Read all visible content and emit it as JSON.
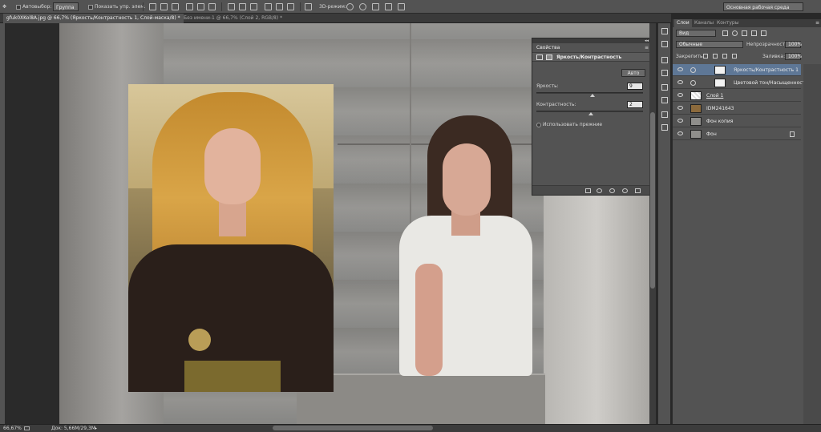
{
  "options_bar": {
    "autoselect_label": "Автовыбор:",
    "autoselect_value": "Группа",
    "show_transform_label": "Показать упр. элем.",
    "mode_3d_label": "3D-режим:",
    "workspace_value": "Основная рабочая среда"
  },
  "tabs": [
    {
      "label": "gfuk0XKol8A.jpg @ 66,7% (Яркость/Контрастность 1, Слой-маска/8) *"
    },
    {
      "label": "Без имени-1 @ 66,7% (Слой 2, RGB/8) *"
    }
  ],
  "properties": {
    "tab_label": "Свойства",
    "adjustment_title": "Яркость/Контрастность",
    "auto_button": "Авто",
    "brightness_label": "Яркость:",
    "brightness_value": "9",
    "brightness_fraction": 0.53,
    "contrast_label": "Контрастность:",
    "contrast_value": "2",
    "contrast_fraction": 0.51,
    "legacy_label": "Использовать прежние"
  },
  "layers_panel": {
    "tabs": [
      "Слои",
      "Каналы",
      "Контуры"
    ],
    "filter_value": "Вид",
    "blend_mode": "Обычные",
    "opacity_label": "Непрозрачность:",
    "opacity_value": "100%",
    "lock_label": "Закрепить:",
    "fill_label": "Заливка:",
    "fill_value": "100%",
    "layers": [
      {
        "name": "Яркость/Контрастность 1",
        "selected": true
      },
      {
        "name": "Цветовой тон/Насыщенност...",
        "selected": false
      },
      {
        "name": "Слой 1",
        "selected": false
      },
      {
        "name": "IDM241643",
        "selected": false
      },
      {
        "name": "Фон копия",
        "selected": false
      },
      {
        "name": "Фон",
        "selected": false
      }
    ]
  },
  "status": {
    "zoom": "66,67%",
    "doc_info": "Док: 5,66M/29,3M"
  },
  "colors": {
    "panel_bg": "#535353",
    "selected_layer": "#5e7796",
    "workspace_bg": "#282828"
  }
}
